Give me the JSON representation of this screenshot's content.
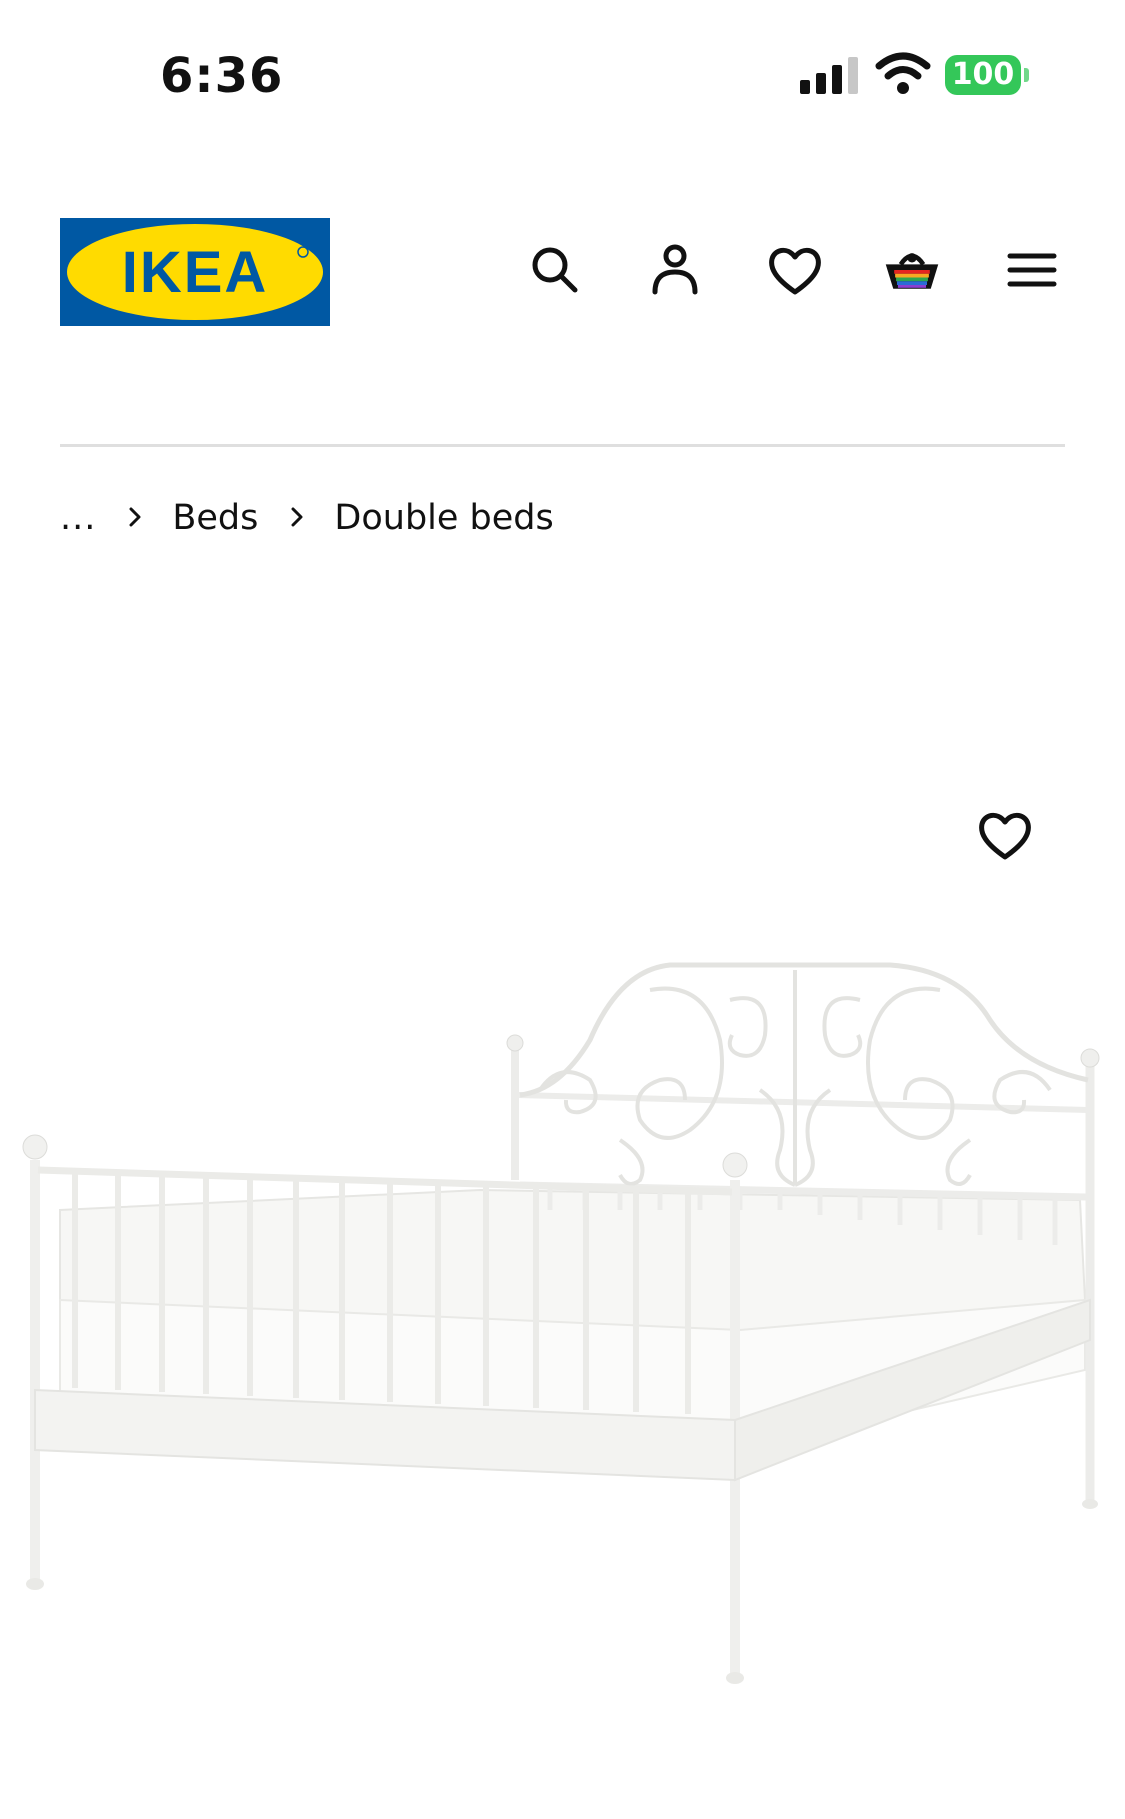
{
  "status_bar": {
    "time": "6:36",
    "battery_level": "100",
    "signal_icon": "cellular-signal-icon",
    "wifi_icon": "wifi-icon"
  },
  "header": {
    "logo_text": "IKEA",
    "logo_colors": {
      "blue": "#0058a3",
      "yellow": "#ffdb00"
    },
    "icons": [
      "search-icon",
      "account-icon",
      "heart-icon",
      "shopping-basket-icon",
      "hamburger-menu-icon"
    ]
  },
  "breadcrumb": {
    "ellipsis": "...",
    "items": [
      "Beds",
      "Double beds"
    ]
  },
  "product": {
    "image_description_icon": "white-metal-double-bed-image",
    "favourite_icon": "heart-outline-icon"
  }
}
